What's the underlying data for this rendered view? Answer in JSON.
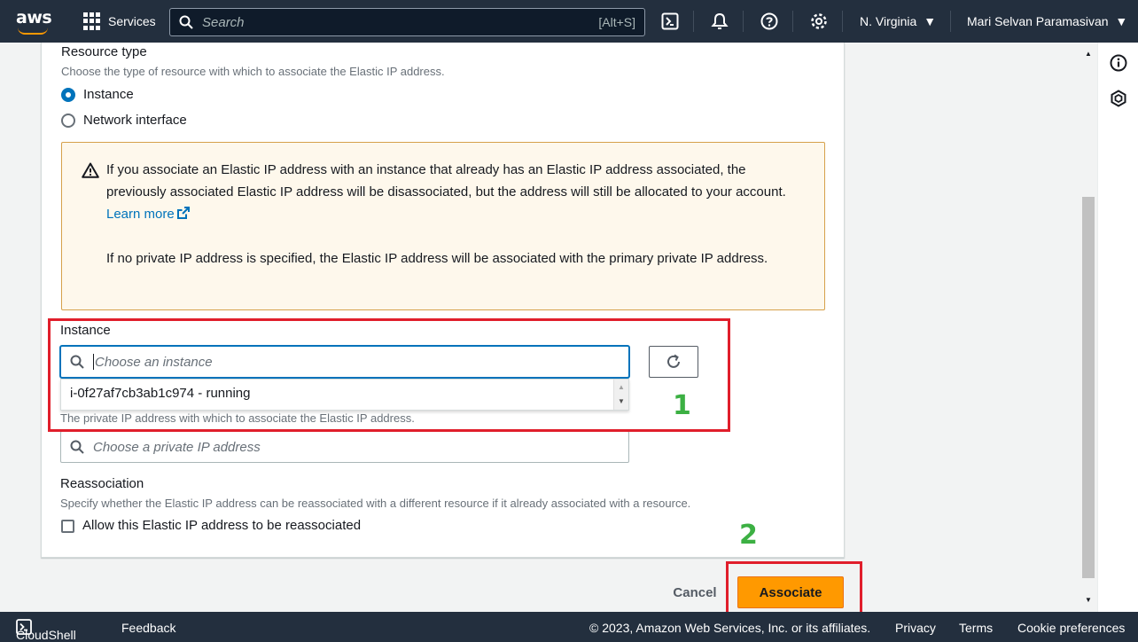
{
  "topnav": {
    "logo_text": "aws",
    "services_label": "Services",
    "search_placeholder": "Search",
    "search_shortcut": "[Alt+S]",
    "region": "N. Virginia",
    "user": "Mari Selvan Paramasivan"
  },
  "form": {
    "resource_type_label": "Resource type",
    "resource_type_desc": "Choose the type of resource with which to associate the Elastic IP address.",
    "options": [
      {
        "label": "Instance",
        "checked": true
      },
      {
        "label": "Network interface",
        "checked": false
      }
    ],
    "alert_text_1": "If you associate an Elastic IP address with an instance that already has an Elastic IP address associated, the previously associated Elastic IP address will be disassociated, but the address will still be allocated to your account.",
    "alert_link": "Learn more",
    "alert_text_2": "If no private IP address is specified, the Elastic IP address will be associated with the primary private IP address.",
    "instance_label": "Instance",
    "instance_placeholder": "Choose an instance",
    "instance_option": "i-0f27af7cb3ab1c974 - running",
    "private_ip_desc": "The private IP address with which to associate the Elastic IP address.",
    "private_ip_placeholder": "Choose a private IP address",
    "reassoc_label": "Reassociation",
    "reassoc_desc": "Specify whether the Elastic IP address can be reassociated with a different resource if it already associated with a resource.",
    "reassoc_checkbox": "Allow this Elastic IP address to be reassociated"
  },
  "actions": {
    "cancel": "Cancel",
    "associate": "Associate"
  },
  "annotations": {
    "step1": "1",
    "step2": "2"
  },
  "footer": {
    "cloudshell": "CloudShell",
    "feedback": "Feedback",
    "copyright": "© 2023, Amazon Web Services, Inc. or its affiliates.",
    "privacy": "Privacy",
    "terms": "Terms",
    "cookies": "Cookie preferences"
  },
  "colors": {
    "nav_bg": "#232f3e",
    "primary_button": "#ff9900",
    "link": "#0073bb",
    "annotation_box": "#e01e2b",
    "annotation_number": "#3cb043",
    "alert_bg": "#fef8ec"
  },
  "icons": [
    "grid-icon",
    "search-icon",
    "cloudshell-icon",
    "bell-icon",
    "help-icon",
    "gear-icon",
    "info-icon",
    "hexagon-icon",
    "warning-icon",
    "external-link-icon",
    "refresh-icon"
  ]
}
